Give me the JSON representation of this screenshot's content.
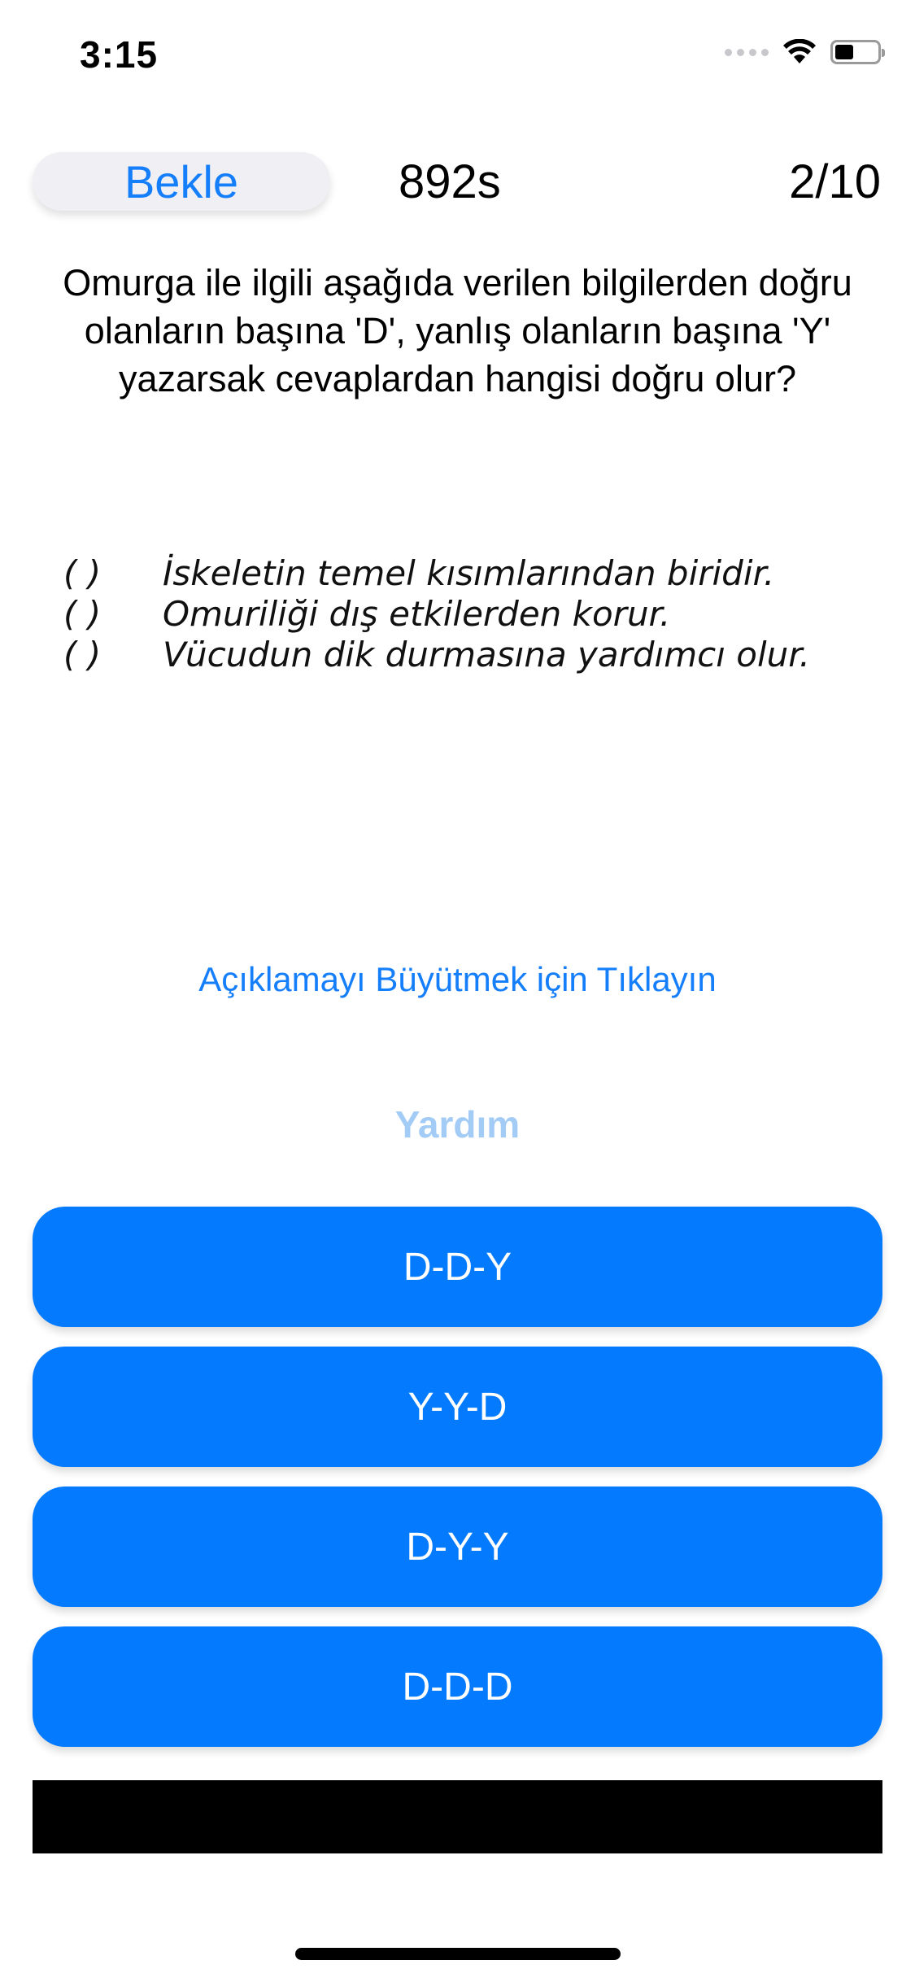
{
  "status_bar": {
    "time": "3:15",
    "icons": [
      "signal-icon",
      "wifi-icon",
      "battery-icon"
    ]
  },
  "header": {
    "wait_label": "Bekle",
    "timer": "892s",
    "progress": "2/10"
  },
  "question": {
    "text": "Omurga ile ilgili aşağıda verilen bilgilerden doğru olanların başına 'D', yanlış olanların başına 'Y' yazarsak cevaplardan hangisi doğru olur?",
    "statements": [
      {
        "paren": "(      )",
        "text": "İskeletin temel kısımlarından biridir."
      },
      {
        "paren": "(      )",
        "text": "Omuriliği dış etkilerden korur."
      },
      {
        "paren": "(      )",
        "text": "Vücudun dik durmasına yardımcı olur."
      }
    ]
  },
  "links": {
    "expand": "Açıklamayı Büyütmek için Tıklayın",
    "help": "Yardım"
  },
  "answers": [
    "D-D-Y",
    "Y-Y-D",
    "D-Y-Y",
    "D-D-D"
  ],
  "colors": {
    "accent": "#147efb",
    "answer_bg": "#047bfe",
    "help_disabled": "#a2cbf6",
    "wait_bg": "#efeff4"
  }
}
